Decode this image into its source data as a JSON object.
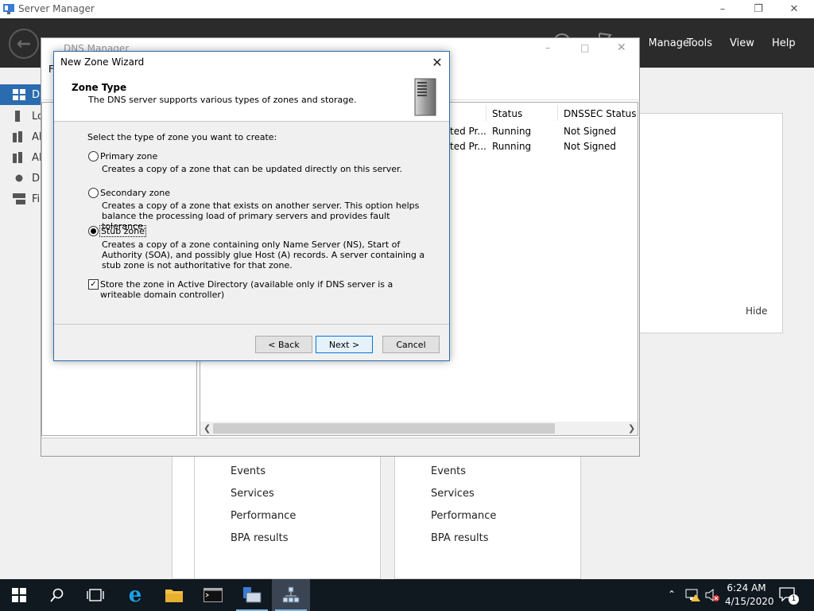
{
  "server_manager": {
    "title": "Server Manager",
    "menu": {
      "manage": "Manage",
      "tools": "Tools",
      "view": "View",
      "help": "Help"
    },
    "nav_items": [
      {
        "label": "Dashboard"
      },
      {
        "label": "Local Server"
      },
      {
        "label": "All Servers"
      },
      {
        "label": "AD DS"
      },
      {
        "label": "DNS"
      },
      {
        "label": "File and Storage Services"
      }
    ],
    "hide_label": "Hide",
    "tiles": [
      {
        "links": [
          "Events",
          "Services",
          "Performance",
          "BPA results"
        ]
      },
      {
        "links": [
          "Events",
          "Services",
          "Performance",
          "BPA results"
        ]
      }
    ]
  },
  "dns_manager": {
    "title": "DNS Manager",
    "menu_first": "F",
    "columns": {
      "status": "Status",
      "dnssec": "DNSSEC Status"
    },
    "rows": [
      {
        "type": "ted Pr...",
        "status": "Running",
        "dnssec": "Not Signed"
      },
      {
        "type": "ted Pr...",
        "status": "Running",
        "dnssec": "Not Signed"
      }
    ]
  },
  "wizard": {
    "title": "New Zone Wizard",
    "heading": "Zone Type",
    "subheading": "The DNS server supports various types of zones and storage.",
    "prompt": "Select the type of zone you want to create:",
    "options": [
      {
        "label": "Primary zone",
        "desc": "Creates a copy of a zone that can be updated directly on this server.",
        "selected": false
      },
      {
        "label": "Secondary zone",
        "desc": "Creates a copy of a zone that exists on another server. This option helps balance the processing load of primary servers and provides fault tolerance.",
        "selected": false
      },
      {
        "label": "Stub zone",
        "desc": "Creates a copy of a zone containing only Name Server (NS), Start of Authority (SOA), and possibly glue Host (A) records. A server containing a stub zone is not authoritative for that zone.",
        "selected": true
      }
    ],
    "store_ad": {
      "label": "Store the zone in Active Directory (available only if DNS server is a writeable domain controller)",
      "checked": true
    },
    "buttons": {
      "back": "< Back",
      "next": "Next >",
      "cancel": "Cancel"
    }
  },
  "taskbar": {
    "time": "6:24 AM",
    "date": "4/15/2020",
    "notification_count": "1"
  }
}
